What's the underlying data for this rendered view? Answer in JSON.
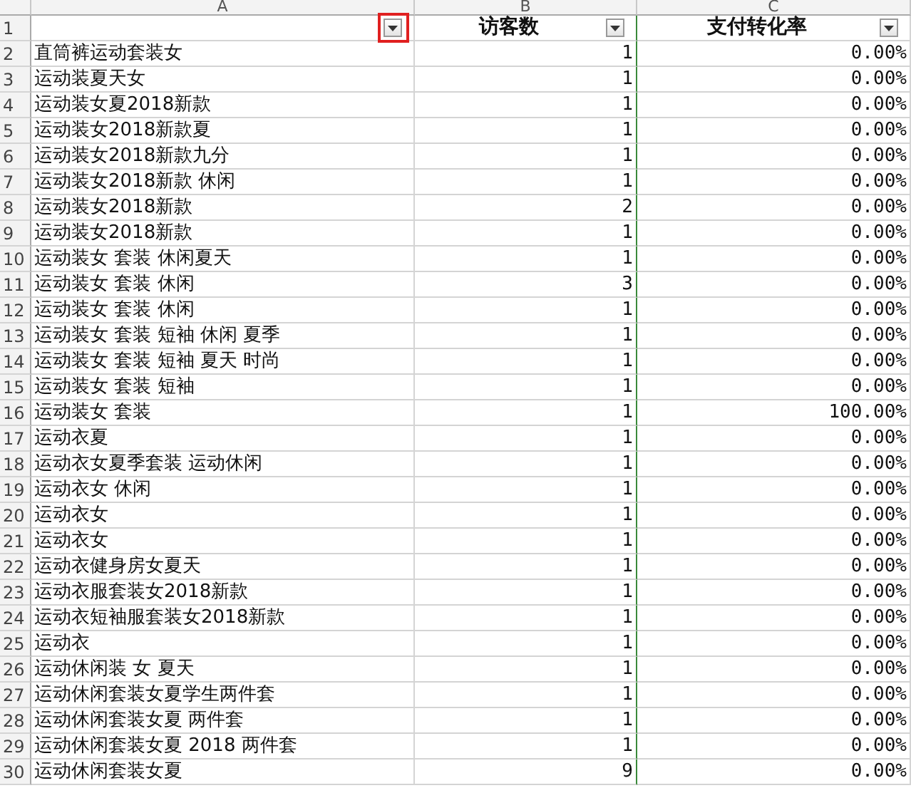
{
  "columns": [
    {
      "letter": "A",
      "filter_highlighted": true
    },
    {
      "letter": "B",
      "header": "访客数",
      "filter_highlighted": false
    },
    {
      "letter": "C",
      "header": "支付转化率",
      "filter_highlighted": false
    }
  ],
  "header_row_number": "1",
  "rows": [
    {
      "number": "2",
      "a": "直筒裤运动套装女",
      "b": "1",
      "c": "0.00%"
    },
    {
      "number": "3",
      "a": "运动装夏天女",
      "b": "1",
      "c": "0.00%"
    },
    {
      "number": "4",
      "a": "运动装女夏2018新款",
      "b": "1",
      "c": "0.00%"
    },
    {
      "number": "5",
      "a": "运动装女2018新款夏",
      "b": "1",
      "c": "0.00%"
    },
    {
      "number": "6",
      "a": "运动装女2018新款九分",
      "b": "1",
      "c": "0.00%"
    },
    {
      "number": "7",
      "a": "运动装女2018新款 休闲",
      "b": "1",
      "c": "0.00%"
    },
    {
      "number": "8",
      "a": "运动装女2018新款",
      "b": "2",
      "c": "0.00%"
    },
    {
      "number": "9",
      "a": "运动装女2018新款",
      "b": "1",
      "c": "0.00%"
    },
    {
      "number": "10",
      "a": "运动装女 套装 休闲夏天",
      "b": "1",
      "c": "0.00%"
    },
    {
      "number": "11",
      "a": "运动装女 套装 休闲",
      "b": "3",
      "c": "0.00%"
    },
    {
      "number": "12",
      "a": "运动装女 套装 休闲",
      "b": "1",
      "c": "0.00%"
    },
    {
      "number": "13",
      "a": "运动装女 套装 短袖 休闲 夏季",
      "b": "1",
      "c": "0.00%"
    },
    {
      "number": "14",
      "a": "运动装女 套装 短袖 夏天 时尚",
      "b": "1",
      "c": "0.00%"
    },
    {
      "number": "15",
      "a": "运动装女 套装 短袖",
      "b": "1",
      "c": "0.00%"
    },
    {
      "number": "16",
      "a": "运动装女 套装",
      "b": "1",
      "c": "100.00%"
    },
    {
      "number": "17",
      "a": "运动衣夏",
      "b": "1",
      "c": "0.00%"
    },
    {
      "number": "18",
      "a": "运动衣女夏季套装 运动休闲",
      "b": "1",
      "c": "0.00%"
    },
    {
      "number": "19",
      "a": "运动衣女 休闲",
      "b": "1",
      "c": "0.00%"
    },
    {
      "number": "20",
      "a": "运动衣女",
      "b": "1",
      "c": "0.00%"
    },
    {
      "number": "21",
      "a": "运动衣女",
      "b": "1",
      "c": "0.00%"
    },
    {
      "number": "22",
      "a": "运动衣健身房女夏天",
      "b": "1",
      "c": "0.00%"
    },
    {
      "number": "23",
      "a": "运动衣服套装女2018新款",
      "b": "1",
      "c": "0.00%"
    },
    {
      "number": "24",
      "a": "运动衣短袖服套装女2018新款",
      "b": "1",
      "c": "0.00%"
    },
    {
      "number": "25",
      "a": "运动衣",
      "b": "1",
      "c": "0.00%"
    },
    {
      "number": "26",
      "a": "运动休闲装 女 夏天",
      "b": "1",
      "c": "0.00%"
    },
    {
      "number": "27",
      "a": "运动休闲套装女夏学生两件套",
      "b": "1",
      "c": "0.00%"
    },
    {
      "number": "28",
      "a": "运动休闲套装女夏 两件套",
      "b": "1",
      "c": "0.00%"
    },
    {
      "number": "29",
      "a": "运动休闲套装女夏 2018 两件套",
      "b": "1",
      "c": "0.00%"
    },
    {
      "number": "30",
      "a": "运动休闲套装女夏",
      "b": "9",
      "c": "0.00%"
    }
  ]
}
